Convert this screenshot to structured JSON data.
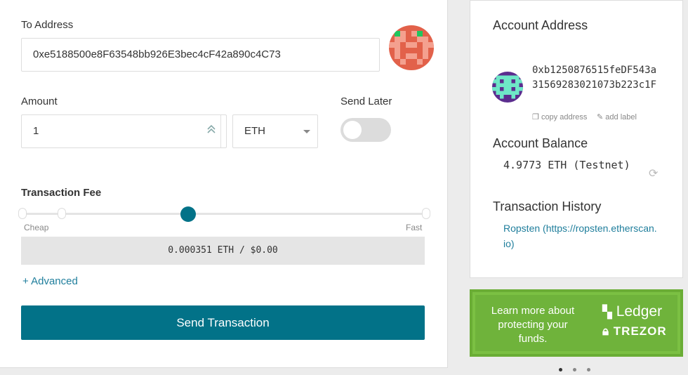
{
  "send": {
    "to_address_label": "To Address",
    "to_address_value": "0xe5188500e8F63548bb926E3bec4cF42a890c4C73",
    "amount_label": "Amount",
    "amount_value": "1",
    "unit_value": "ETH",
    "send_later_label": "Send Later",
    "send_later_enabled": false,
    "fee_title": "Transaction Fee",
    "fee_cheap_label": "Cheap",
    "fee_fast_label": "Fast",
    "fee_level_fraction": 0.4,
    "fee_value": "0.000351 ETH / $0.00",
    "advanced_label": "+ Advanced",
    "send_button_label": "Send Transaction"
  },
  "account": {
    "address_title": "Account Address",
    "address_value": "0xb1250876515feDF543a31569283021073b223c1F",
    "copy_label": "copy address",
    "label_label": "add label",
    "balance_title": "Account Balance",
    "balance_value": "4.9773 ETH (Testnet)",
    "history_title": "Transaction History",
    "history_link": "Ropsten (https://ropsten.etherscan.io)"
  },
  "promo": {
    "text": "Learn more about protecting your funds.",
    "ledger": "Ledger",
    "trezor": "TREZOR",
    "color": "#7bc043"
  },
  "colors": {
    "accent": "#027288",
    "link": "#1f7e9c"
  }
}
